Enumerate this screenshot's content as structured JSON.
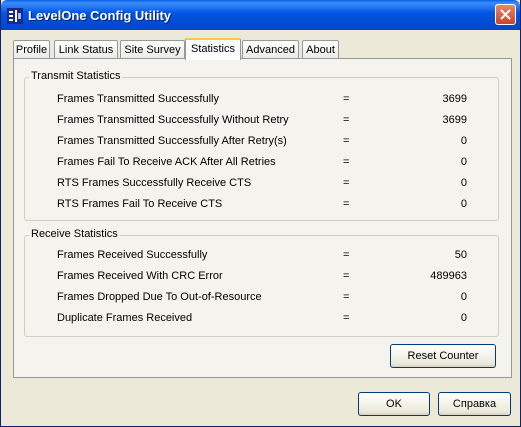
{
  "window": {
    "title": "LevelOne Config Utility"
  },
  "tabs": [
    {
      "label": "Profile"
    },
    {
      "label": "Link Status"
    },
    {
      "label": "Site Survey"
    },
    {
      "label": "Statistics"
    },
    {
      "label": "Advanced"
    },
    {
      "label": "About"
    }
  ],
  "active_tab": "Statistics",
  "transmit": {
    "title": "Transmit Statistics",
    "rows": [
      {
        "label": "Frames Transmitted Successfully",
        "eq": "=",
        "value": "3699"
      },
      {
        "label": "Frames Transmitted Successfully  Without Retry",
        "eq": "=",
        "value": "3699"
      },
      {
        "label": "Frames Transmitted Successfully After Retry(s)",
        "eq": "=",
        "value": "0"
      },
      {
        "label": "Frames Fail To Receive ACK After All Retries",
        "eq": "=",
        "value": "0"
      },
      {
        "label": "RTS Frames Successfully Receive CTS",
        "eq": "=",
        "value": "0"
      },
      {
        "label": "RTS Frames Fail To Receive CTS",
        "eq": "=",
        "value": "0"
      }
    ]
  },
  "receive": {
    "title": "Receive Statistics",
    "rows": [
      {
        "label": "Frames Received Successfully",
        "eq": "=",
        "value": "50"
      },
      {
        "label": "Frames Received With CRC Error",
        "eq": "=",
        "value": "489963"
      },
      {
        "label": "Frames Dropped Due To Out-of-Resource",
        "eq": "=",
        "value": "0"
      },
      {
        "label": "Duplicate Frames Received",
        "eq": "=",
        "value": "0"
      }
    ]
  },
  "buttons": {
    "reset": "Reset Counter",
    "ok": "OK",
    "help": "Справка"
  },
  "colors": {
    "titlebar": "#0054e3",
    "close": "#c9452b",
    "tab_highlight": "#ffc73c"
  }
}
